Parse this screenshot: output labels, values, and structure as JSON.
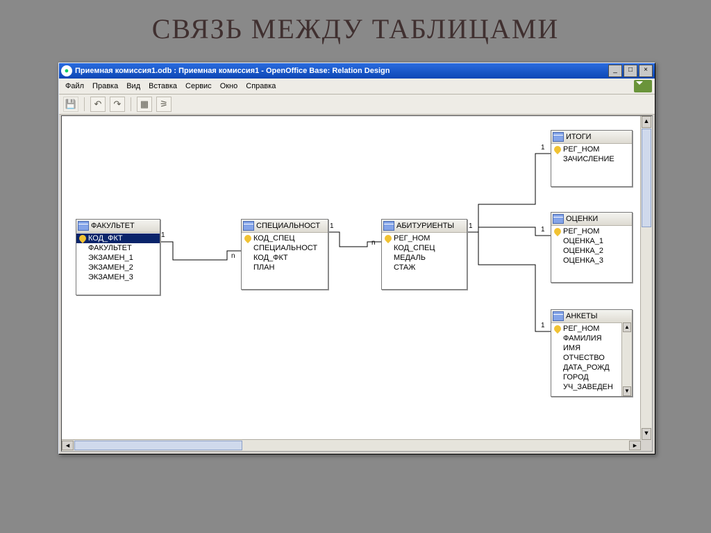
{
  "slide_title": "СВЯЗЬ МЕЖДУ ТАБЛИЦАМИ",
  "window": {
    "title": "Приемная комиссия1.odb : Приемная комиссия1 - OpenOffice Base: Relation Design",
    "controls": {
      "min": "_",
      "max": "□",
      "close": "×"
    }
  },
  "menu": [
    "Файл",
    "Правка",
    "Вид",
    "Вставка",
    "Сервис",
    "Окно",
    "Справка"
  ],
  "tables": {
    "fac": {
      "title": "ФАКУЛЬТЕТ",
      "fields": [
        {
          "name": "КОД_ФКТ",
          "key": true,
          "selected": true
        },
        {
          "name": "ФАКУЛЬТЕТ"
        },
        {
          "name": "ЭКЗАМЕН_1"
        },
        {
          "name": "ЭКЗАМЕН_2"
        },
        {
          "name": "ЭКЗАМЕН_3"
        }
      ]
    },
    "spec": {
      "title": "СПЕЦИАЛЬНОСТ",
      "fields": [
        {
          "name": "КОД_СПЕЦ",
          "key": true
        },
        {
          "name": "СПЕЦИАЛЬНОСТ"
        },
        {
          "name": "КОД_ФКТ"
        },
        {
          "name": "ПЛАН"
        }
      ]
    },
    "abit": {
      "title": "АБИТУРИЕНТЫ",
      "fields": [
        {
          "name": "РЕГ_НОМ",
          "key": true
        },
        {
          "name": "КОД_СПЕЦ"
        },
        {
          "name": "МЕДАЛЬ"
        },
        {
          "name": "СТАЖ"
        }
      ]
    },
    "itogi": {
      "title": "ИТОГИ",
      "fields": [
        {
          "name": "РЕГ_НОМ",
          "key": true
        },
        {
          "name": "ЗАЧИСЛЕНИЕ"
        }
      ]
    },
    "ocen": {
      "title": "ОЦЕНКИ",
      "fields": [
        {
          "name": "РЕГ_НОМ",
          "key": true
        },
        {
          "name": "ОЦЕНКА_1"
        },
        {
          "name": "ОЦЕНКА_2"
        },
        {
          "name": "ОЦЕНКА_3"
        }
      ]
    },
    "ank": {
      "title": "АНКЕТЫ",
      "fields": [
        {
          "name": "РЕГ_НОМ",
          "key": true
        },
        {
          "name": "ФАМИЛИЯ"
        },
        {
          "name": "ИМЯ"
        },
        {
          "name": "ОТЧЕСТВО"
        },
        {
          "name": "ДАТА_РОЖД"
        },
        {
          "name": "ГОРОД"
        },
        {
          "name": "УЧ_ЗАВЕДЕН"
        }
      ]
    }
  },
  "labels": {
    "one": "1",
    "many": "n"
  }
}
